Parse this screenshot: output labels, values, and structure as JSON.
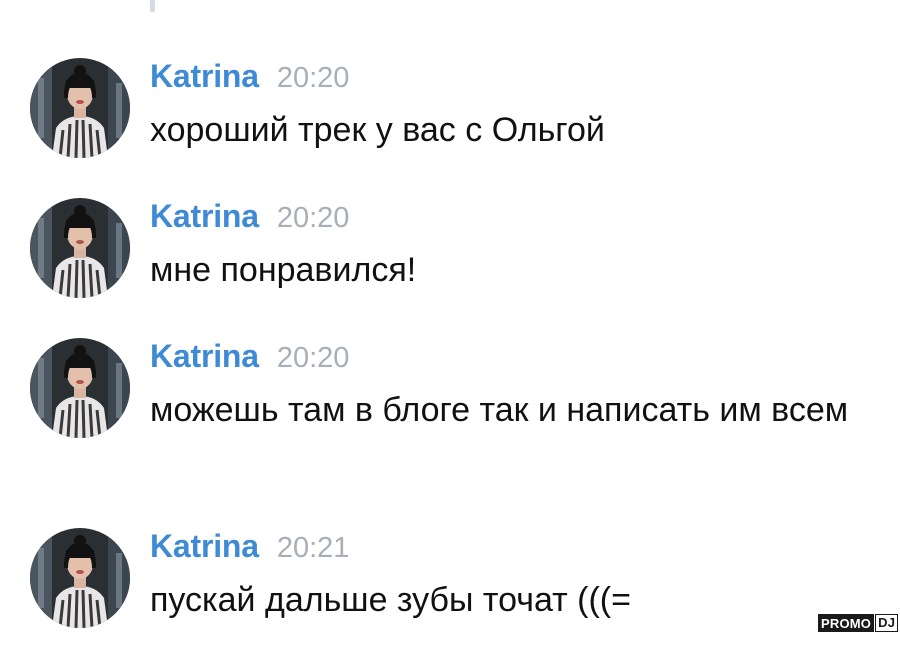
{
  "messages": [
    {
      "author": "Katrina",
      "time": "20:20",
      "text": "хороший трек у вас с Ольгой"
    },
    {
      "author": "Katrina",
      "time": "20:20",
      "text": "мне понравился!"
    },
    {
      "author": "Katrina",
      "time": "20:20",
      "text": "можешь там в блоге так и написать им всем"
    },
    {
      "author": "Katrina",
      "time": "20:21",
      "text": "пускай дальше зубы точат (((="
    }
  ],
  "watermark": {
    "part1": "PROMO",
    "part2": "DJ"
  },
  "colors": {
    "author": "#3f8ad4",
    "time": "#a8afb8",
    "text": "#111111",
    "background": "#ffffff"
  },
  "icons": {
    "avatar": "user-avatar-photo"
  }
}
